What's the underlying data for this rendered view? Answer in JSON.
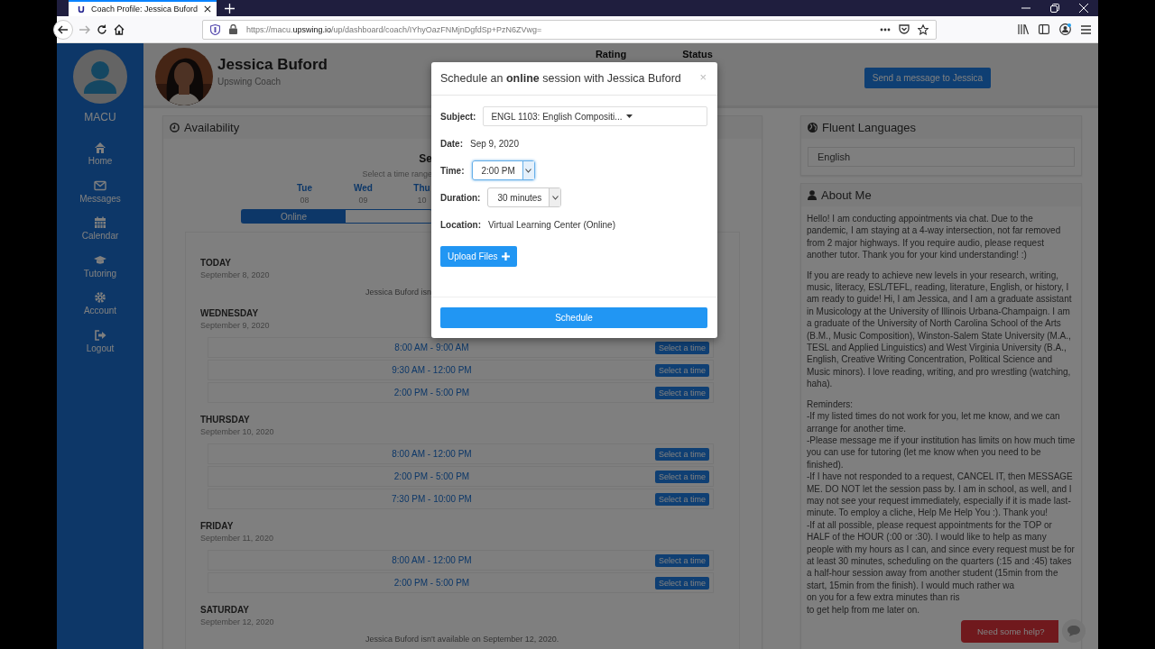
{
  "browser": {
    "tab": {
      "title": "Coach Profile: Jessica Buford",
      "selected": true
    },
    "url": "https://macu.**upswing.io**/up/dashboard/coach/IYhyOazFNMjnDgfdSp+PzN6ZVwg="
  },
  "sidebar": {
    "brand": "MACU",
    "items": [
      {
        "label": "Home"
      },
      {
        "label": "Messages"
      },
      {
        "label": "Calendar"
      },
      {
        "label": "Tutoring"
      },
      {
        "label": "Account"
      },
      {
        "label": "Logout"
      }
    ]
  },
  "profile": {
    "name": "Jessica Buford",
    "role": "Upswing Coach",
    "columns": [
      "Rating",
      "Status"
    ],
    "message_button": "Send a message to Jessica"
  },
  "availability": {
    "title": "Availability",
    "heading": "Se",
    "hint": "Select a time range",
    "days": [
      {
        "day": "Tue",
        "date": "08"
      },
      {
        "day": "Wed",
        "date": "09"
      },
      {
        "day": "Thu",
        "date": "10"
      }
    ],
    "modes": [
      {
        "label": "Online",
        "selected": true
      }
    ],
    "schedule": [
      {
        "name": "TODAY",
        "date": "September 8, 2020",
        "note": "Jessica Buford isn"
      },
      {
        "name": "WEDNESDAY",
        "date": "September 9, 2020",
        "slots": [
          {
            "time": "8:00 AM - 9:00 AM",
            "action": "Select a time"
          },
          {
            "time": "9:30 AM - 12:00 PM",
            "action": "Select a time"
          },
          {
            "time": "2:00 PM - 5:00 PM",
            "action": "Select a time"
          }
        ]
      },
      {
        "name": "THURSDAY",
        "date": "September 10, 2020",
        "slots": [
          {
            "time": "8:00 AM - 12:00 PM",
            "action": "Select a time"
          },
          {
            "time": "2:00 PM - 5:00 PM",
            "action": "Select a time"
          },
          {
            "time": "7:30 PM - 10:00 PM",
            "action": "Select a time"
          }
        ]
      },
      {
        "name": "FRIDAY",
        "date": "September 11, 2020",
        "slots": [
          {
            "time": "8:00 AM - 12:00 PM",
            "action": "Select a time"
          },
          {
            "time": "2:00 PM - 5:00 PM",
            "action": "Select a time"
          }
        ]
      },
      {
        "name": "SATURDAY",
        "date": "September 12, 2020",
        "note": "Jessica Buford isn't available on September 12, 2020."
      }
    ]
  },
  "languages": {
    "title": "Fluent Languages",
    "items": [
      "English"
    ]
  },
  "about": {
    "title": "About Me",
    "paragraphs": [
      "Hello! I am conducting appointments via chat. Due to the pandemic, I am staying at a 4-way intersection, not far removed from 2 major highways. If you require audio, please request another tutor. Thank you for your kind understanding! :)",
      "If you are ready to achieve new levels in your research, writing, music, literacy, ESL/TEFL, reading, literature, English, or history, I am ready to guide! Hi, I am Jessica, and I am a graduate assistant in Musicology at the University of Illinois Urbana-Champaign. I am a graduate of the University of North Carolina School of the Arts (B.M., Music Composition), Winston-Salem State University (M.A., TESL and Applied Linguistics) and West Virginia University (B.A., English, Creative Writing Concentration, Political Science and Music minors). I love reading, writing, and pro wrestling (watching, haha)."
    ],
    "reminders": [
      "Reminders:",
      "-If my listed times do not work for you, let me know, and we can arrange for another time.",
      "-Please message me if your institution has limits on how much time you can use for tutoring (let me know when you need to be finished).",
      "-If I have not responded to a request, CANCEL IT, then MESSAGE ME. DO NOT let the session pass by. I am in school, as well, and I may not see your request immediately, especially if it is made last-minute. To employ a cliche, Help Me Help You :). Thank you!",
      "-If at all possible, please request appointments for the TOP or HALF of the HOUR (:00 or :30). I would like to help as many people with my hours as I can, and since every request must be for at least 30 minutes, scheduling on the quarters (:15 and :45) takes a half-hour session away from another student (15min from the start, 15min from the finish). I would much rather wa",
      "on you for a few extra minutes than ris",
      "to get help from me later on."
    ]
  },
  "help_widget": {
    "label": "Need some help?"
  },
  "modal": {
    "title": "Schedule an **online** session with Jessica Buford",
    "close": "×",
    "fields": [
      {
        "kind": "select",
        "label": "Subject:",
        "value": "ENGL 1103: English Compositi..."
      },
      {
        "kind": "text",
        "label": "Date:",
        "value": "Sep 9, 2020"
      },
      {
        "kind": "dropdown",
        "label": "Time:",
        "value": "2:00 PM",
        "focused": true
      },
      {
        "kind": "dropdown",
        "label": "Duration:",
        "value": "30 minutes",
        "focused": false
      },
      {
        "kind": "text",
        "label": "Location:",
        "value": "Virtual Learning Center (Online)"
      }
    ],
    "upload_button": "Upload Files",
    "submit_button": "Schedule"
  }
}
